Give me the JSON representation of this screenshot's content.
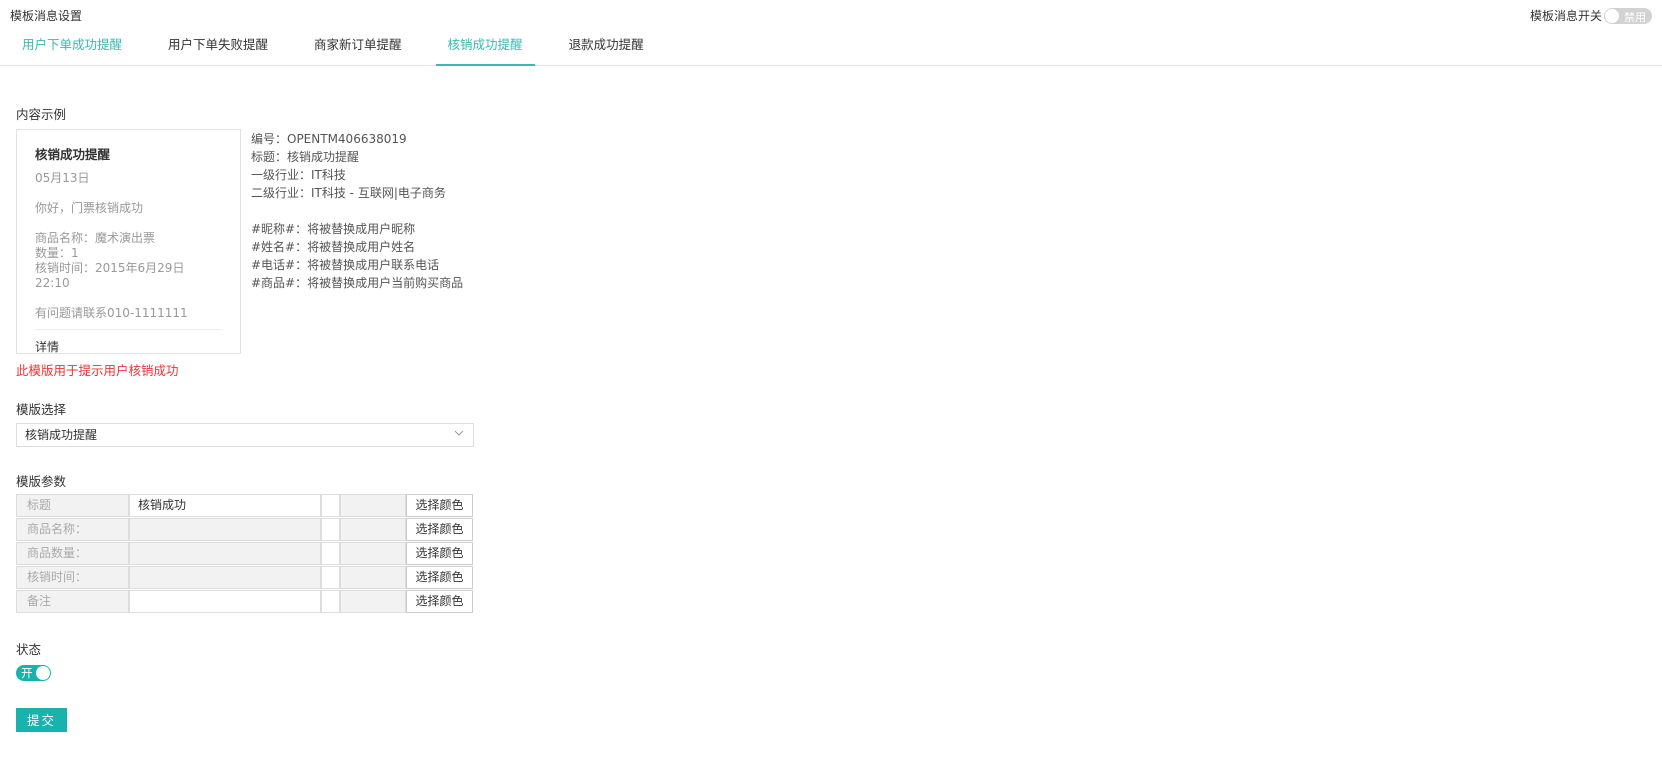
{
  "header": {
    "title": "模板消息设置",
    "switch_label": "模板消息开关",
    "switch_state": "禁用"
  },
  "tabs": [
    {
      "label": "用户下单成功提醒"
    },
    {
      "label": "用户下单失败提醒"
    },
    {
      "label": "商家新订单提醒"
    },
    {
      "label": "核销成功提醒"
    },
    {
      "label": "退款成功提醒"
    }
  ],
  "preview": {
    "section_label": "内容示例",
    "card": {
      "title": "核销成功提醒",
      "date": "05月13日",
      "greeting": "你好，门票核销成功",
      "product": "商品名称：魔术演出票",
      "quantity": "数量：1",
      "time": "核销时间：2015年6月29日 22:10",
      "contact": "有问题请联系010-1111111",
      "detail": "详情"
    },
    "info": {
      "number": "编号：OPENTM406638019",
      "title": "标题：核销成功提醒",
      "industry1": "一级行业：IT科技",
      "industry2": "二级行业：IT科技 - 互联网|电子商务",
      "var_nickname": "#昵称#：将被替换成用户昵称",
      "var_name": "#姓名#：将被替换成用户姓名",
      "var_phone": "#电话#：将被替换成用户联系电话",
      "var_product": "#商品#：将被替换成用户当前购买商品"
    },
    "note": "此模版用于提示用户核销成功"
  },
  "template_select": {
    "label": "模版选择",
    "value": "核销成功提醒"
  },
  "params": {
    "label": "模版参数",
    "color_button": "选择颜色",
    "rows": [
      {
        "label": "标题",
        "value": "核销成功"
      },
      {
        "label": "商品名称：",
        "value": ""
      },
      {
        "label": "商品数量：",
        "value": ""
      },
      {
        "label": "核销时间：",
        "value": ""
      },
      {
        "label": "备注",
        "value": ""
      }
    ]
  },
  "status": {
    "label": "状态",
    "toggle_text": "开"
  },
  "submit": {
    "label": "提交"
  },
  "colors": {
    "accent": "#17b3ac",
    "tab_active": "#3ab8b4",
    "note_red": "#ee3333"
  }
}
